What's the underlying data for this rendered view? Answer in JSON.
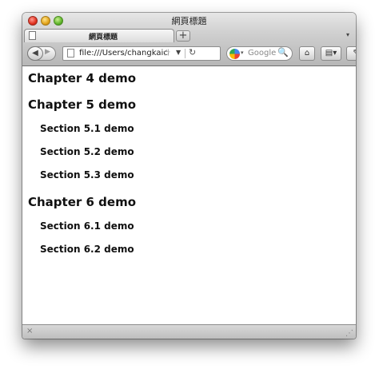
{
  "window": {
    "title": "網頁標題"
  },
  "tab": {
    "title": "網頁標題",
    "new_tab_label": "+",
    "menu_glyph": "▾"
  },
  "nav": {
    "back_glyph": "◀",
    "forward_glyph": "▶"
  },
  "urlbar": {
    "value": "file:///Users/changkaichun/",
    "star_glyph": "☆",
    "drop_glyph": "▼",
    "reload_glyph": "↻"
  },
  "search": {
    "placeholder": "Google",
    "drop_glyph": "▾",
    "search_glyph": "🔍"
  },
  "toolbar": {
    "home_glyph": "⌂",
    "bookmarks_glyph": "▤▾",
    "extension_glyph": "✎▾"
  },
  "content": {
    "items": [
      {
        "level": 2,
        "text": "Chapter 4 demo"
      },
      {
        "level": 2,
        "text": "Chapter 5 demo"
      },
      {
        "level": 3,
        "text": "Section 5.1 demo"
      },
      {
        "level": 3,
        "text": "Section 5.2 demo"
      },
      {
        "level": 3,
        "text": "Section 5.3 demo"
      },
      {
        "level": 2,
        "text": "Chapter 6 demo"
      },
      {
        "level": 3,
        "text": "Section 6.1 demo"
      },
      {
        "level": 3,
        "text": "Section 6.2 demo"
      }
    ]
  },
  "statusbar": {
    "close_glyph": "×",
    "grip_glyph": "⋰"
  },
  "colors": {
    "titlebar_top": "#e6e6e6",
    "titlebar_bottom": "#b7b7b7",
    "close": "#e0301e",
    "minimize": "#e2a319",
    "maximize": "#5fb52b"
  }
}
